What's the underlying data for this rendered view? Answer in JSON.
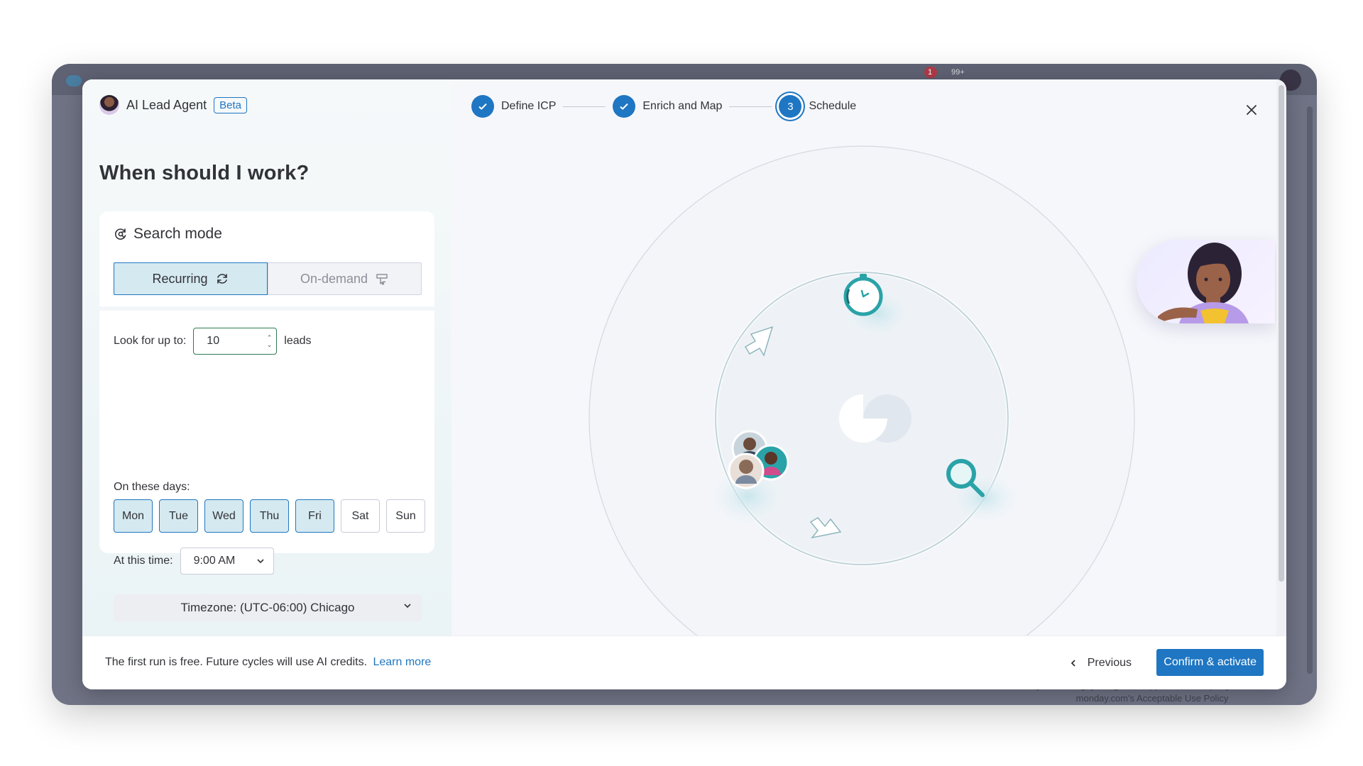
{
  "modal": {
    "agent_name": "AI Lead Agent",
    "beta_label": "Beta",
    "heading": "When should I work?"
  },
  "search_mode": {
    "title": "Search mode",
    "options": [
      {
        "label": "Recurring",
        "icon": "refresh-icon",
        "selected": true
      },
      {
        "label": "On-demand",
        "icon": "hand-pointer-icon",
        "selected": false
      }
    ]
  },
  "lookup": {
    "label": "Look for up to:",
    "value": "10",
    "suffix": "leads"
  },
  "days": {
    "label": "On these days:",
    "items": [
      {
        "label": "Mon",
        "selected": true
      },
      {
        "label": "Tue",
        "selected": true
      },
      {
        "label": "Wed",
        "selected": true
      },
      {
        "label": "Thu",
        "selected": true
      },
      {
        "label": "Fri",
        "selected": true
      },
      {
        "label": "Sat",
        "selected": false
      },
      {
        "label": "Sun",
        "selected": false
      }
    ]
  },
  "time": {
    "label": "At this time:",
    "value": "9:00 AM"
  },
  "timezone": {
    "value": "Timezone: (UTC-06:00) Chicago"
  },
  "steps": [
    {
      "label": "Define ICP",
      "state": "done"
    },
    {
      "label": "Enrich and Map",
      "state": "done"
    },
    {
      "label": "Schedule",
      "state": "current",
      "number": "3"
    }
  ],
  "footer": {
    "note": "The first run is free. Future cycles will use AI credits.",
    "learn_more": "Learn more",
    "previous": "Previous",
    "confirm": "Confirm & activate"
  },
  "background": {
    "notification_count": "1",
    "inbox_count": "99+",
    "legal_text": "By continuing, you agree to applicable third-party terms and monday.com's Acceptable Use Policy"
  },
  "colors": {
    "primary": "#1f76c2",
    "selected_bg": "#d5e9f0",
    "input_border": "#2e7b52",
    "teal": "#2aa3a8"
  }
}
